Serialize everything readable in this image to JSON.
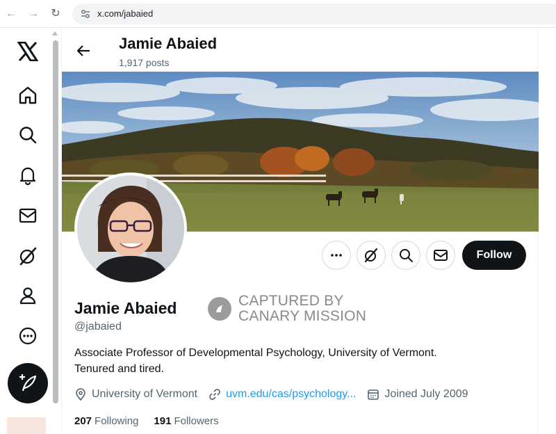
{
  "browser": {
    "url": "x.com/jabaied",
    "icons": [
      "back-arrow-icon",
      "forward-arrow-icon",
      "reload-icon",
      "site-settings-icon"
    ]
  },
  "left_nav": {
    "items": [
      {
        "name": "x-logo-icon"
      },
      {
        "name": "home-icon"
      },
      {
        "name": "search-icon"
      },
      {
        "name": "notifications-bell-icon"
      },
      {
        "name": "messages-envelope-icon"
      },
      {
        "name": "grok-icon"
      },
      {
        "name": "profile-person-icon"
      },
      {
        "name": "more-circle-icon"
      }
    ],
    "post_button_icon": "compose-feather-icon"
  },
  "header": {
    "name": "Jamie Abaied",
    "posts": "1,917 posts"
  },
  "profile": {
    "display_name": "Jamie Abaied",
    "handle": "@jabaied",
    "bio_line1": "Associate Professor of Developmental Psychology, University of Vermont.",
    "bio_line2": "Tenured and tired.",
    "location": "University of Vermont",
    "website": "uvm.edu/cas/psychology...",
    "joined": "Joined July 2009",
    "following_count": "207",
    "following_label": "Following",
    "followers_count": "191",
    "followers_label": "Followers"
  },
  "actions": {
    "follow_label": "Follow",
    "icons": [
      "more-dots-icon",
      "grok-icon",
      "search-icon",
      "envelope-icon"
    ]
  },
  "watermark": {
    "line1": "CAPTURED BY",
    "line2": "CANARY MISSION"
  },
  "colors": {
    "text_primary": "#0f1419",
    "text_secondary": "#536471",
    "link": "#1d9bf0",
    "follow_bg": "#0f1419"
  }
}
